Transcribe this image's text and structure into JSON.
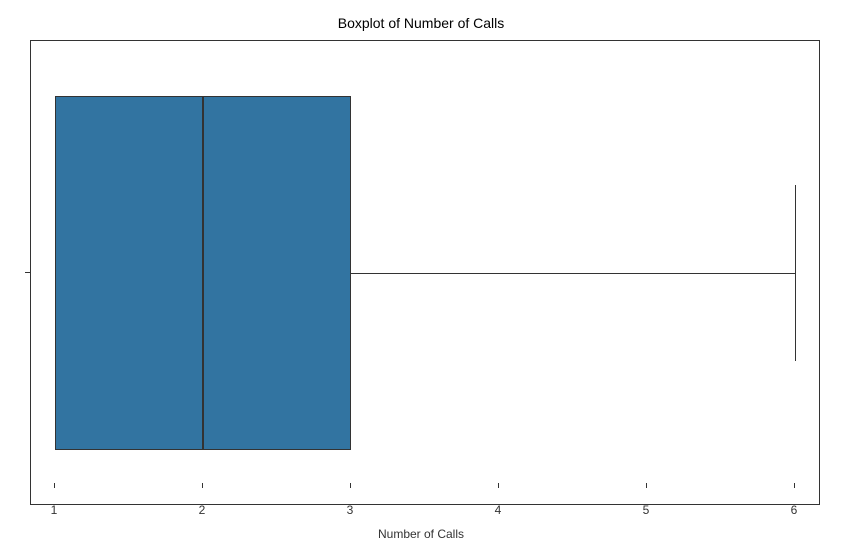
{
  "chart_data": {
    "type": "boxplot",
    "orientation": "horizontal",
    "title": "Boxplot of Number of Calls",
    "xlabel": "Number of Calls",
    "ylabel": "",
    "xlim": [
      0.7,
      6.3
    ],
    "xticks": [
      1,
      2,
      3,
      4,
      5,
      6
    ],
    "ytick_labels": [
      ""
    ],
    "q1": 1,
    "median": 2,
    "q3": 3,
    "whisker_min": 1,
    "whisker_max": 6,
    "outliers": [],
    "box_color": "#3274a1"
  },
  "ticks": {
    "x1": "1",
    "x2": "2",
    "x3": "3",
    "x4": "4",
    "x5": "5",
    "x6": "6"
  }
}
